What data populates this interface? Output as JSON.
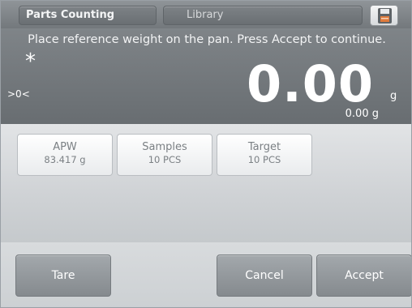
{
  "header": {
    "app_tab": "Parts Counting",
    "library_tab": "Library",
    "save_icon": "floppy-disk-icon"
  },
  "display": {
    "prompt": "Place reference weight on the pan.  Press Accept to continue.",
    "stable_indicator": "*",
    "center_of_zero": ">0<",
    "main_weight": "0.00",
    "unit": "g",
    "secondary_weight": "0.00 g"
  },
  "info_cards": [
    {
      "label": "APW",
      "value": "83.417 g"
    },
    {
      "label": "Samples",
      "value": "10 PCS"
    },
    {
      "label": "Target",
      "value": "10 PCS"
    }
  ],
  "buttons": {
    "tare": "Tare",
    "cancel": "Cancel",
    "accept": "Accept"
  },
  "colors": {
    "display_bg": "#74797d",
    "button_bg": "#969b9f",
    "card_bg": "#f4f5f6"
  }
}
